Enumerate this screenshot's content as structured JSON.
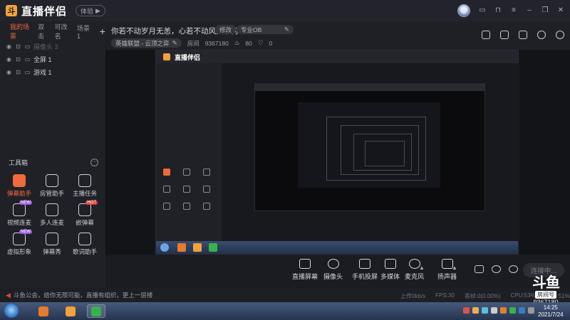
{
  "app": {
    "name": "直播伴侣",
    "trial_label": "体验",
    "trial_icon": "play-icon"
  },
  "window_controls": [
    "min-icon",
    "restore-icon",
    "close-icon"
  ],
  "scenes": {
    "tabs": [
      {
        "label": "我的场景",
        "active": true
      },
      {
        "label": "双击",
        "active": false
      },
      {
        "label": "可改名",
        "active": false
      },
      {
        "label": "场景1",
        "active": false
      }
    ],
    "add_label": "+",
    "sources": [
      {
        "label": "摄像头 3",
        "dim": true
      },
      {
        "label": "全屏 1",
        "dim": false
      },
      {
        "label": "游戏 1",
        "dim": false
      }
    ]
  },
  "tools": {
    "title": "工具箱",
    "more": "···",
    "items": [
      {
        "label": "弹幕助手",
        "icon": "danmaku-helper-icon",
        "hot": true,
        "badge": ""
      },
      {
        "label": "房管助手",
        "icon": "admin-helper-icon",
        "hot": false,
        "badge": ""
      },
      {
        "label": "主播任务",
        "icon": "task-icon",
        "hot": false,
        "badge": ""
      },
      {
        "label": "视频连麦",
        "icon": "video-link-icon",
        "hot": false,
        "badge": "NEW"
      },
      {
        "label": "多人连麦",
        "icon": "multi-link-icon",
        "hot": false,
        "badge": ""
      },
      {
        "label": "嵌弹幕",
        "icon": "embed-danmaku-icon",
        "hot": false,
        "badge": "HOT"
      },
      {
        "label": "虚拟形象",
        "icon": "avatar-icon",
        "hot": false,
        "badge": "NEW"
      },
      {
        "label": "弹幕秀",
        "icon": "danmaku-show-icon",
        "hot": false,
        "badge": ""
      },
      {
        "label": "歌词助手",
        "icon": "lyrics-icon",
        "hot": false,
        "badge": ""
      }
    ]
  },
  "room": {
    "title": "你若不动岁月无恙，心若不动风又奈何",
    "edit_label": "修改",
    "category_label": "专业OB",
    "game_label": "英雄联盟 - 云顶之弈",
    "room_id_label": "房间",
    "room_id": "9367180",
    "hot_value": "80",
    "fans_value": "0"
  },
  "room_icons": [
    "layout-icon",
    "screenshot-icon",
    "record-icon",
    "bell-icon",
    "settings-icon"
  ],
  "controls": {
    "items": [
      {
        "label": "直播屏幕",
        "icon": "screen-icon"
      },
      {
        "label": "摄像头",
        "icon": "camera-icon"
      },
      {
        "label": "手机投屏",
        "icon": "phone-cast-icon"
      },
      {
        "label": "多媒体",
        "icon": "media-icon"
      },
      {
        "label": "麦克风",
        "icon": "microphone-icon"
      },
      {
        "label": "扬声器",
        "icon": "speaker-icon"
      }
    ],
    "connect_label": "连接中..."
  },
  "status": {
    "notice": "斗鱼公会，给你无限可能，直播有组织，更上一层楼",
    "upload": "上传0kb/s",
    "fps": "FPS:30",
    "loss": "丢帧:0(0.00%)",
    "cpu": "CPU:53%",
    "mem": "内存:51%"
  },
  "watermark": {
    "logo": "斗鱼",
    "sub": "房间号",
    "id": "9367180"
  },
  "taskbar": {
    "apps": [
      {
        "name": "app-douyu-1",
        "color": "#e87a2e"
      },
      {
        "name": "app-douyu-2",
        "color": "#f2a23a"
      },
      {
        "name": "app-wechat",
        "color": "#37b24d"
      }
    ],
    "time": "14:25",
    "date": "2021/7/24"
  },
  "colors": {
    "accent": "#f06a3b",
    "bg": "#1b1c22",
    "panel": "#202127"
  }
}
